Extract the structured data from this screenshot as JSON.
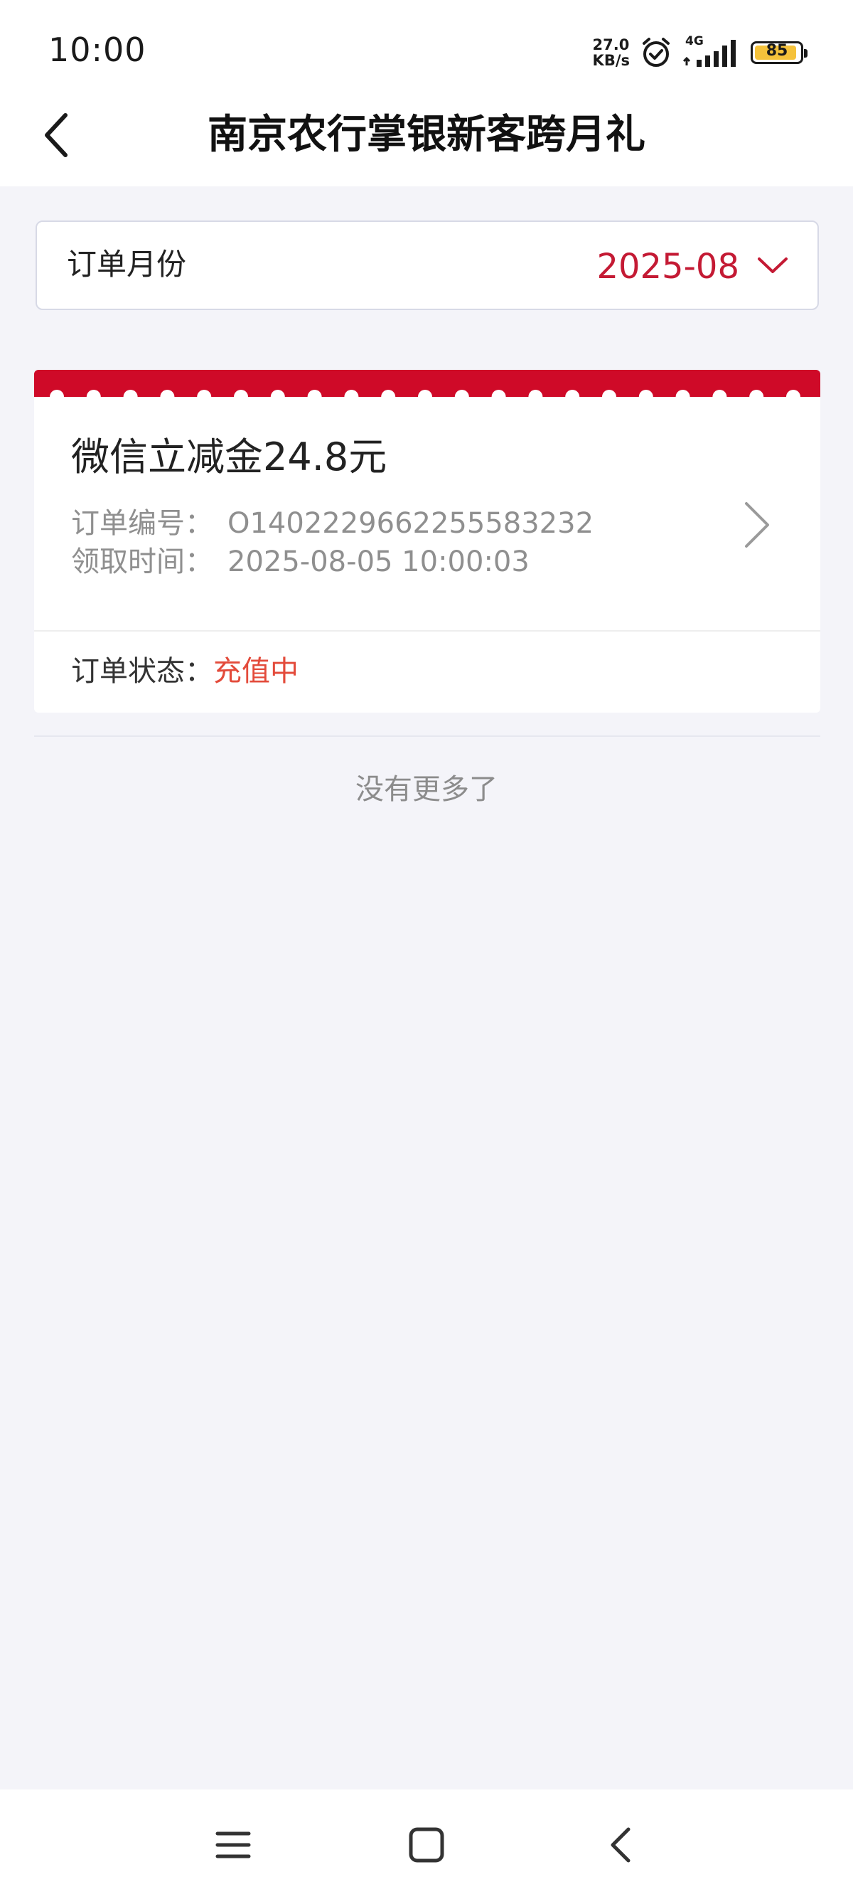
{
  "status_bar": {
    "time": "10:00",
    "net_speed_value": "27.0",
    "net_speed_unit": "KB/s",
    "network_type": "4G",
    "battery_level": "85",
    "icons": [
      "alarm-icon",
      "signal-icon",
      "battery-icon"
    ]
  },
  "header": {
    "title": "南京农行掌银新客跨月礼",
    "back_icon": "back-arrow-icon"
  },
  "filter": {
    "label": "订单月份",
    "value": "2025-08",
    "icon": "chevron-down-icon"
  },
  "order": {
    "product": "微信立减金24.8元",
    "id_label": "订单编号：",
    "id_value": "O140222966225558323​2",
    "time_label": "领取时间：",
    "time_value": "2025-08-05 10:00:03",
    "status_label": "订单状态：",
    "status_value": "充值中",
    "accent_color": "#cf0a28",
    "status_color": "#e34b3b"
  },
  "list_end_text": "没有更多了",
  "nav_bar": {
    "icons": [
      "menu-icon",
      "home-icon",
      "back-icon"
    ]
  }
}
